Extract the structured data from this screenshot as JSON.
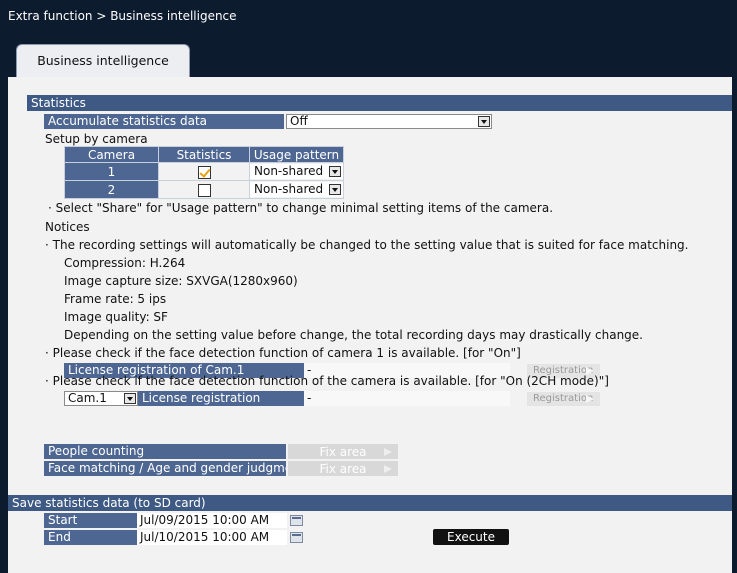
{
  "breadcrumb": "Extra function > Business intelligence",
  "tab": "Business intelligence",
  "statistics": {
    "header": "Statistics",
    "accumulate_label": "Accumulate statistics data",
    "accumulate_value": "Off",
    "setup_by_camera": "Setup by camera",
    "table_headers": [
      "Camera",
      "Statistics",
      "Usage pattern"
    ],
    "rows": [
      {
        "camera": "1",
        "checked": true,
        "usage": "Non-shared"
      },
      {
        "camera": "2",
        "checked": false,
        "usage": "Non-shared"
      }
    ],
    "share_note": "· Select \"Share\" for \"Usage pattern\" to change minimal setting items of the camera.",
    "notices_label": "Notices",
    "notice1": "· The recording settings will automatically be changed to the setting value that is suited for face matching.",
    "compression": "Compression: H.264",
    "capture_size": "Image capture size: SXVGA(1280x960)",
    "frame_rate": "Frame rate: 5 ips",
    "image_quality": "Image quality: SF",
    "depending": "Depending on the setting value before change, the total recording days may drastically change.",
    "notice2": "· Please check if the face detection function of camera 1 is available. [for \"On\"]",
    "license_cam1_label": "License registration of Cam.1",
    "license_cam1_value": "-",
    "registration_btn": "Registration",
    "notice3": "· Please check if the face detection function of the camera is available. [for \"On (2CH mode)\"]",
    "cam_select": "Cam.1",
    "license_label": "License registration",
    "license_value": "-",
    "registration_btn2": "Registration",
    "people_counting": "People counting",
    "face_matching": "Face matching / Age and gender judgment",
    "fix_area": "Fix area",
    "fix_area2": "Fix area"
  },
  "save": {
    "header": "Save statistics data (to SD card)",
    "start_label": "Start",
    "start_value": "Jul/09/2015 10:00 AM",
    "end_label": "End",
    "end_value": "Jul/10/2015 10:00 AM",
    "execute": "Execute"
  },
  "colors": {
    "background": "#0d1b2e",
    "panel": "#f2f2f2",
    "section_header": "#3e5a84",
    "label_bg": "#4e6792",
    "checkmark": "#e8a010"
  }
}
